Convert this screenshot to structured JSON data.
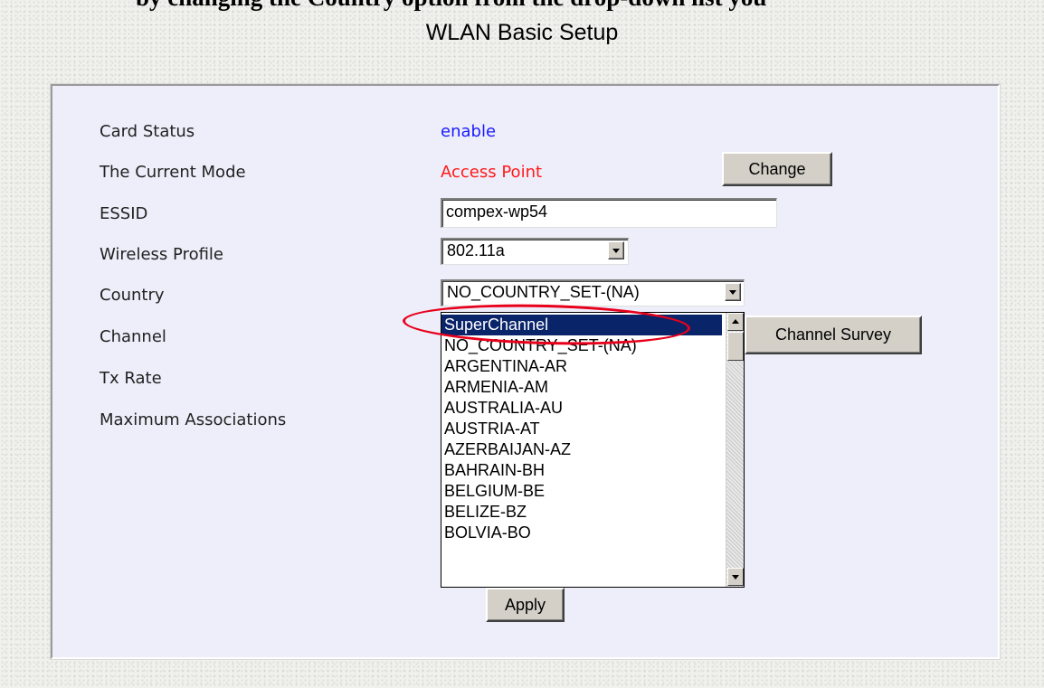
{
  "cut_heading": "by changing the Country option from the drop-down list you",
  "page_title": "WLAN Basic Setup",
  "fields": {
    "card_status": {
      "label": "Card Status",
      "value": "enable"
    },
    "current_mode": {
      "label": "The Current Mode",
      "value": "Access Point",
      "button": "Change"
    },
    "essid": {
      "label": "ESSID",
      "value": "compex-wp54"
    },
    "wireless_profile": {
      "label": "Wireless Profile",
      "value": "802.11a"
    },
    "country": {
      "label": "Country",
      "value": "NO_COUNTRY_SET-(NA)"
    },
    "channel": {
      "label": "Channel",
      "survey_button": "Channel Survey"
    },
    "tx_rate": {
      "label": "Tx Rate"
    },
    "max_assoc": {
      "label": "Maximum Associations"
    }
  },
  "country_options": [
    "SuperChannel",
    "NO_COUNTRY_SET-(NA)",
    "ARGENTINA-AR",
    "ARMENIA-AM",
    "AUSTRALIA-AU",
    "AUSTRIA-AT",
    "AZERBAIJAN-AZ",
    "BAHRAIN-BH",
    "BELGIUM-BE",
    "BELIZE-BZ",
    "BOLVIA-BO"
  ],
  "highlighted_option": "SuperChannel",
  "apply_button": "Apply",
  "colors": {
    "status_value": "#1a1aff",
    "mode_value": "#ff1a1a",
    "selection": "#0a246a",
    "annotation": "#e8001a",
    "panel": "#eeeefa"
  },
  "icons": [
    "dropdown-arrow-icon",
    "scroll-up-icon",
    "scroll-down-icon"
  ]
}
